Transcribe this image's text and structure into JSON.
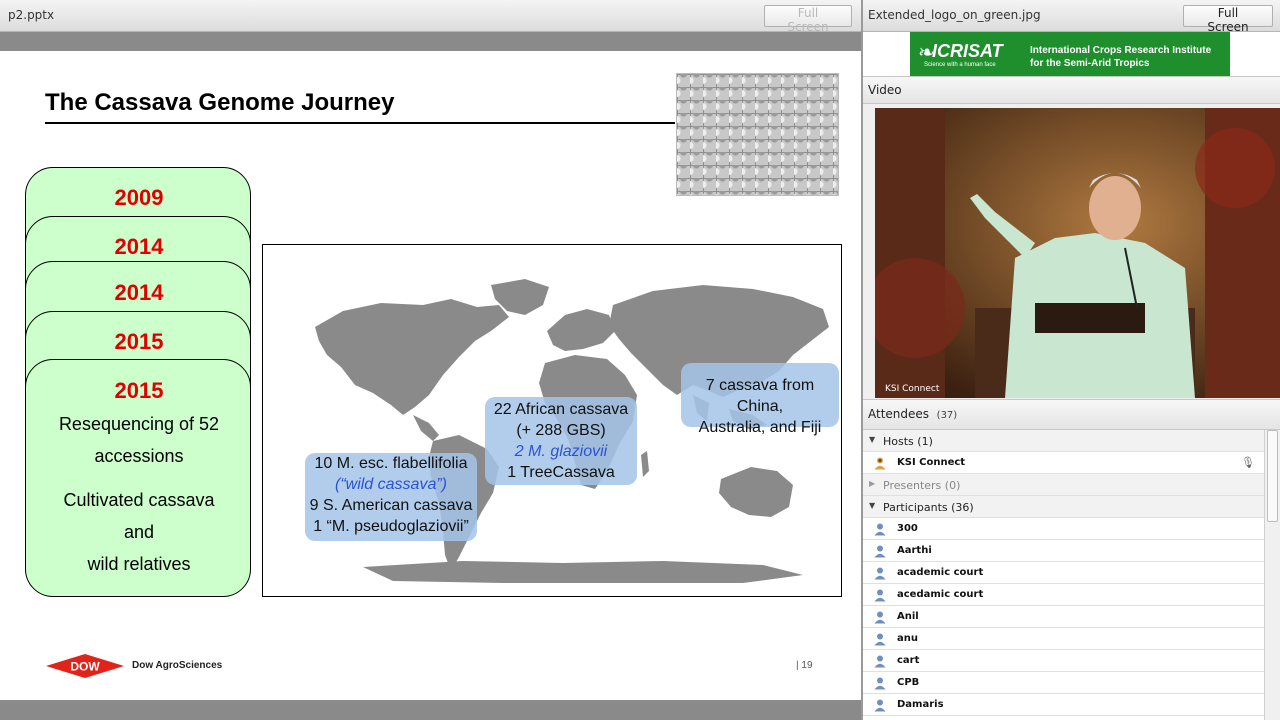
{
  "presentation_pod": {
    "title": "p2.pptx",
    "full_screen_label": "Full Screen"
  },
  "slide": {
    "title": "The Cassava Genome Journey",
    "timeline": [
      {
        "year": "2009"
      },
      {
        "year": "2014"
      },
      {
        "year": "2014"
      },
      {
        "year": "2015"
      },
      {
        "year": "2015",
        "lines": [
          "Resequencing of 52",
          "accessions",
          "Cultivated cassava",
          "and",
          "wild relatives"
        ]
      }
    ],
    "map_labels": {
      "south_america": {
        "line1": "10 M. esc. flabellifolia",
        "line2": "(“wild cassava”)",
        "line3": "9 S. American cassava",
        "line4": "1 “M. pseudoglaziovii”"
      },
      "africa": {
        "line1": "22 African cassava",
        "line2": "(+ 288 GBS)",
        "line3": "2 M. glaziovii",
        "line4": "1 TreeCassava"
      },
      "asia": {
        "line1": "7 cassava from China,",
        "line2": "Australia, and Fiji"
      }
    },
    "footer": {
      "logo_text": "DOW",
      "company": "Dow AgroSciences",
      "page_number": "19"
    }
  },
  "logo_pod": {
    "title": "Extended_logo_on_green.jpg",
    "full_screen_label": "Full Screen",
    "logo_word": "ICRISAT",
    "logo_tagline": "Science with a human face",
    "logo_org_line1": "International Crops Research Institute",
    "logo_org_line2": "for the Semi-Arid Tropics"
  },
  "video_pod": {
    "title": "Video",
    "caption": "KSI Connect"
  },
  "attendees_pod": {
    "title": "Attendees",
    "count": "(37)",
    "hosts_label": "Hosts (1)",
    "hosts": [
      "KSI Connect"
    ],
    "presenters_label": "Presenters (0)",
    "participants_label": "Participants (36)",
    "participants": [
      "300",
      "Aarthi",
      "academic court",
      "acedamic court",
      "Anil",
      "anu",
      "cart",
      "CPB",
      "Damaris"
    ]
  },
  "colors": {
    "card_fill": "#ccffcc",
    "year_red": "#e10000",
    "icrisat_green": "#1f8f2e",
    "map_land": "#8a8a8a",
    "label_blue": "#a3c4e8"
  }
}
